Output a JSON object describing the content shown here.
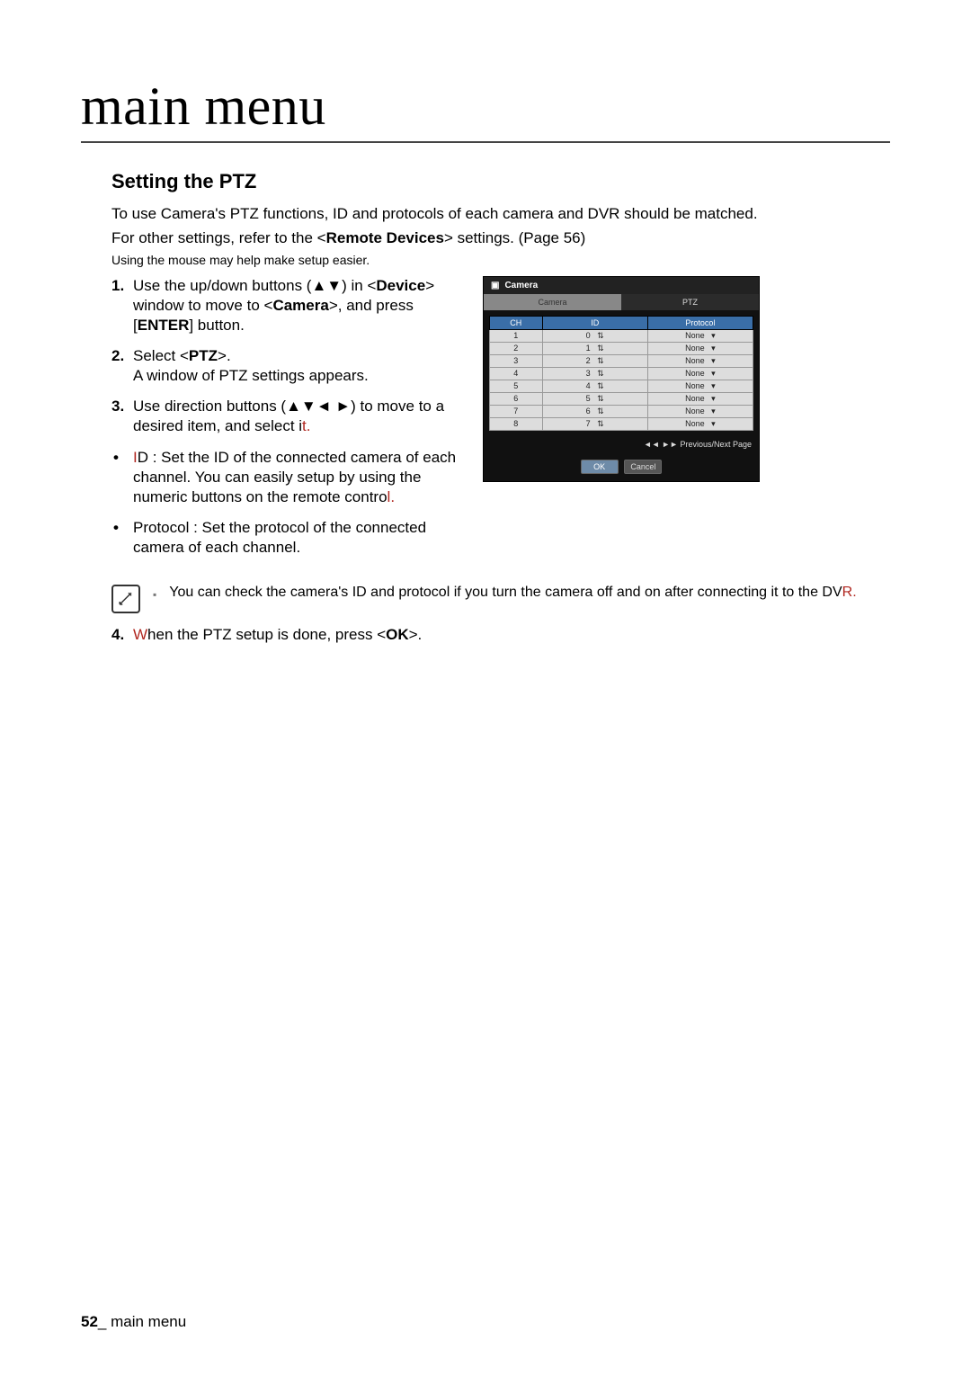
{
  "header": {
    "title": "main menu"
  },
  "section": {
    "title": "Setting the PTZ",
    "intro1": "To use Camera's PTZ functions, ID and protocols of each camera and DVR should be matched.",
    "intro2_a": "For other settings, refer to the <",
    "intro2_b": "Remote Devices",
    "intro2_c": "> settings. (Page 56)",
    "small": "Using the mouse may help make setup easier."
  },
  "steps": {
    "s1_a": "Use the up/down buttons (▲▼) in <",
    "s1_b": "Device",
    "s1_c": "> window to move to <",
    "s1_d": "Camera",
    "s1_e": ">, and press [",
    "s1_f": "ENTER",
    "s1_g": "] button.",
    "s2_a": "Select <",
    "s2_b": "PTZ",
    "s2_c": ">.",
    "s2_line2": "A window of PTZ settings appears.",
    "s3_a": "Use direction buttons (▲▼◄ ►) to move to a desired item, and select i",
    "s3_b": "t.",
    "b1_a": "I",
    "b1_b": "D : Set the ID of the connected camera of each channel. You can easily setup by using the numeric buttons on the remote contro",
    "b1_c": "l.",
    "b2": "Protocol : Set the protocol of the connected camera of each channel.",
    "note_a": "You can check the camera's ID and protocol if you turn the camera off and on after connecting it to the DV",
    "note_b": "R.",
    "s4_a": "W",
    "s4_b": "hen the PTZ setup is done, press <",
    "s4_c": "OK",
    "s4_d": ">."
  },
  "dvr": {
    "title": "Camera",
    "tabs": [
      "Camera",
      "PTZ"
    ],
    "headers": {
      "ch": "CH",
      "id": "ID",
      "protocol": "Protocol"
    },
    "rows": [
      {
        "ch": "1",
        "id": "0",
        "protocol": "None"
      },
      {
        "ch": "2",
        "id": "1",
        "protocol": "None"
      },
      {
        "ch": "3",
        "id": "2",
        "protocol": "None"
      },
      {
        "ch": "4",
        "id": "3",
        "protocol": "None"
      },
      {
        "ch": "5",
        "id": "4",
        "protocol": "None"
      },
      {
        "ch": "6",
        "id": "5",
        "protocol": "None"
      },
      {
        "ch": "7",
        "id": "6",
        "protocol": "None"
      },
      {
        "ch": "8",
        "id": "7",
        "protocol": "None"
      }
    ],
    "prevnext": "◄◄ ►► Previous/Next Page",
    "ok": "OK",
    "cancel": "Cancel"
  },
  "footer": {
    "page": "52",
    "sep": "_ ",
    "label": "main menu"
  }
}
